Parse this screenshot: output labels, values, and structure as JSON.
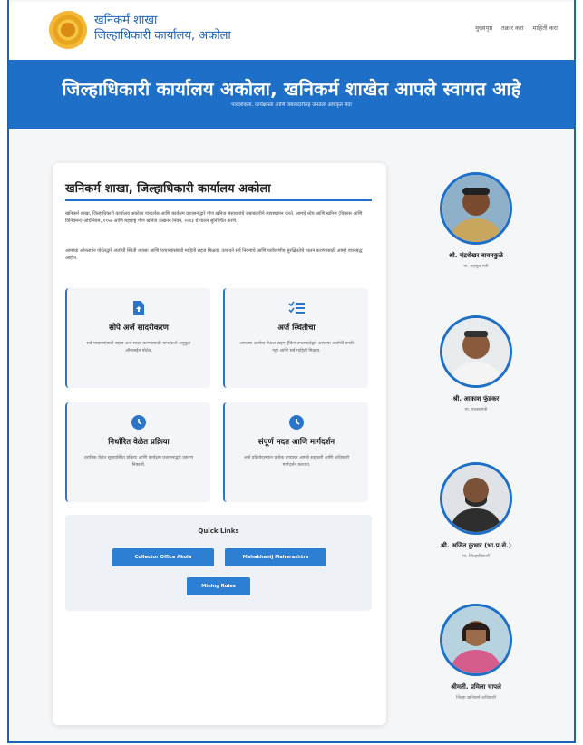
{
  "header": {
    "brand_line1": "खनिकर्म शाखा",
    "brand_line2": "जिल्हाधिकारी कार्यालय, अकोला",
    "nav": [
      "मुख्यपृष्ठ",
      "तक्रार करा",
      "माहिती करा"
    ]
  },
  "hero": {
    "title": "जिल्हाधिकारी कार्यालय अकोला, खनिकर्म शाखेत आपले स्वागत आहे",
    "subtitle": "पारदर्शकता, कार्यक्षमता आणि जबाबदारीसह जनतेला अधिकृत सेवा"
  },
  "main": {
    "title": "खनिकर्म शाखा, जिल्हाधिकारी कार्यालय अकोला",
    "para1": "खनिकर्म शाखा, जिल्हाधिकारी कार्यालय अकोला पारदर्शक आणि कार्यक्षम प्रशासनाद्वारे गौण खनिज संसाधनांचे जबाबदारीने व्यवस्थापन करते. आमचे ध्येय आणि खनिज (विकास आणि विनियमन) अधिनियम, १९५७ आणि महाराष्ट्र गौण खनिज उत्खनन नियम, २०१३ चे पालन सुनिश्चित करणे.",
    "para2": "आमच्या ऑनलाईन पोर्टलद्वारे अर्जांची स्थिती तपासा आणि परवान्यांसंबंधी माहिती सहज मिळवा. उत्पादने सर्व नियमांचे आणि पर्यावरणीय सुरक्षिततेचे पालन करण्यासाठी आम्ही वचनबद्ध आहोत.",
    "features": [
      {
        "title": "सोपे अर्ज सादरीकरण",
        "desc": "सर्व परवान्यांसाठी सहज अर्ज सादर करण्यासाठी वापरकर्ता-अनुकूल ऑनलाईन पोर्टल."
      },
      {
        "title": "अर्ज स्थितीचा",
        "desc": "आपल्या अर्जाचा रिअल-टाइम ट्रॅकिंग उपलब्धतेद्वारे आपल्या अर्जाची प्रगती पहा आणि सर्व माहिती मिळवा."
      },
      {
        "title": "निर्धारित वेळेत प्रक्रिया",
        "desc": "ठराविक वेळेत सुव्यवस्थित प्रक्रिया आणि कार्यक्षम प्रशासनाद्वारे प्रकरण निकाली."
      },
      {
        "title": "संपूर्ण मदत आणि मार्गदर्शन",
        "desc": "अर्ज प्रक्रियेदरम्यान प्रत्येक टप्प्यावर आमचे सहकारी आणि अधिकारी मार्गदर्शन करतात."
      }
    ],
    "quick_links": {
      "title": "Quick Links",
      "buttons": [
        "Collector Office Akola",
        "Mahakhanij Maharashtra",
        "Mining Rules"
      ]
    }
  },
  "people": [
    {
      "name": "श्री. चंद्रशेखर बावनकुळे",
      "role": "मा. महसूल मंत्री"
    },
    {
      "name": "श्री. आकाश फुंडकर",
      "role": "मा. पालकमंत्री"
    },
    {
      "name": "श्री. अजित कुंभार (भा.प्र.से.)",
      "role": "मा. जिल्हाधिकारी"
    },
    {
      "name": "श्रीमती. प्रमिला चापले",
      "role": "जिल्हा खनिकर्म अधिकारी"
    }
  ],
  "colors": {
    "primary": "#1e6fc8",
    "button": "#2d7fd4",
    "background": "#f4f6f8"
  }
}
